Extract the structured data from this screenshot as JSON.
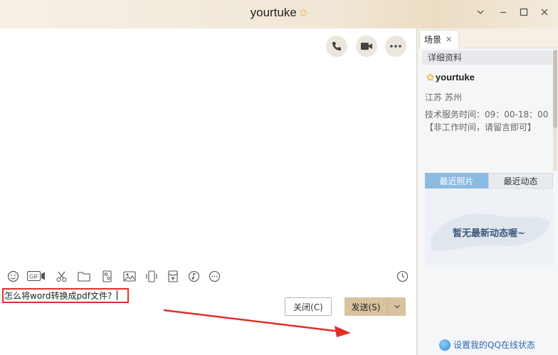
{
  "window": {
    "title": "yourtuke"
  },
  "chat": {
    "input_text": "怎么将word转换成pdf文件?",
    "close_label": "关闭(C)",
    "send_label": "发送(S)"
  },
  "side": {
    "tab_label": "场景",
    "section_header": "详细资料",
    "profile": {
      "name": "yourtuke",
      "location": "江苏  苏州",
      "description": "技术服务时间：09：00-18：00【非工作时间，请留言即可】"
    },
    "photo_tabs": [
      "最近照片",
      "最近动态"
    ],
    "empty_message": "暂无最新动态喔~",
    "qq_status_link": "设置我的QQ在线状态"
  },
  "colors": {
    "accent": "#d9c29e",
    "highlight": "#e0302a",
    "star": "#f2a81d"
  }
}
